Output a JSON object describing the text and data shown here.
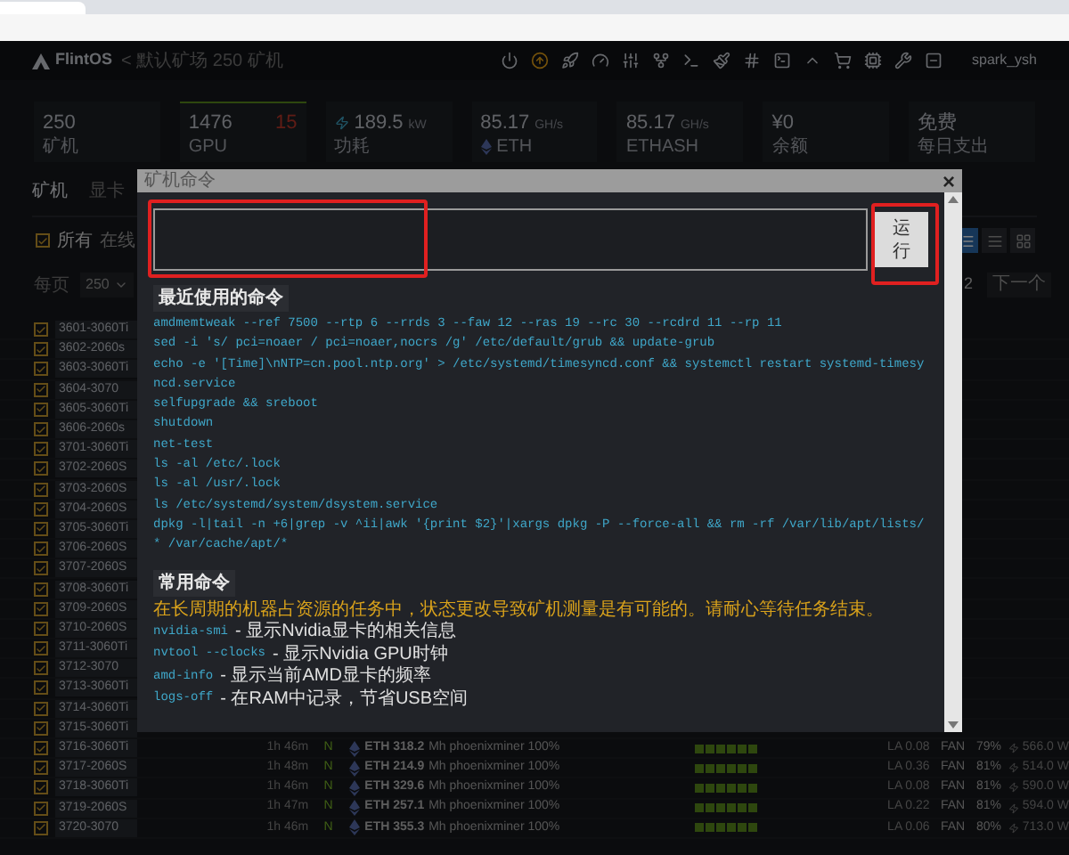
{
  "header": {
    "logo": "FlintOS",
    "breadcrumb": "< 默认矿场 250 矿机",
    "user": "spark_ysh"
  },
  "stats": [
    {
      "value": "250",
      "label": "矿机",
      "selected": false
    },
    {
      "value": "1476",
      "alert": "15",
      "label": "GPU",
      "selected": true
    },
    {
      "value": "189.5",
      "unit": "kW",
      "label": "功耗",
      "kind": "power",
      "selected": false
    },
    {
      "value": "85.17",
      "unit": "GH/s",
      "label": "ETH",
      "kind": "eth",
      "selected": false
    },
    {
      "value": "85.17",
      "unit": "GH/s",
      "label": "ETHASH",
      "selected": false
    },
    {
      "value": "¥0",
      "label": "余额",
      "selected": false
    },
    {
      "value": "免费",
      "label": "每日支出",
      "selected": false
    }
  ],
  "tabs": [
    {
      "label": "矿机",
      "selected": true
    },
    {
      "label": "显卡",
      "selected": false
    }
  ],
  "filter": {
    "checked": true,
    "label": "所有",
    "next": "在线"
  },
  "per_page": {
    "label": "每页",
    "value": "250"
  },
  "views": [
    {
      "kind": "list",
      "selected": true
    },
    {
      "kind": "table",
      "selected": false
    },
    {
      "kind": "grid",
      "selected": false
    }
  ],
  "pagination": {
    "page": "2",
    "next": "下一个"
  },
  "rows": [
    {
      "name": "3601-3060Ti",
      "checked": true
    },
    {
      "name": "3602-2060s",
      "checked": true
    },
    {
      "name": "3603-3060Ti",
      "checked": true
    },
    {
      "name": "3604-3070",
      "checked": true
    },
    {
      "name": "3605-3060Ti",
      "checked": true
    },
    {
      "name": "3606-2060s",
      "checked": true
    },
    {
      "name": "3701-3060Ti",
      "checked": true
    },
    {
      "name": "3702-2060S",
      "checked": true
    },
    {
      "name": "3703-2060S",
      "checked": true
    },
    {
      "name": "3704-2060S",
      "checked": true
    },
    {
      "name": "3705-3060Ti",
      "checked": true
    },
    {
      "name": "3706-2060S",
      "checked": true
    },
    {
      "name": "3707-2060S",
      "checked": true
    },
    {
      "name": "3708-3060Ti",
      "checked": true
    },
    {
      "name": "3709-2060S",
      "checked": true
    },
    {
      "name": "3710-2060S",
      "checked": true
    },
    {
      "name": "3711-3060Ti",
      "checked": true
    },
    {
      "name": "3712-3070",
      "checked": true
    },
    {
      "name": "3713-3060Ti",
      "checked": true
    },
    {
      "name": "3714-3060Ti",
      "checked": true
    },
    {
      "name": "3715-3060Ti",
      "checked": true
    },
    {
      "name": "3716-3060Ti",
      "checked": true,
      "details": {
        "uptime": "1h 46m",
        "flag": "N",
        "coin": "ETH",
        "hashrate": "318.2",
        "miner": "Mh phoenixminer 100%",
        "la": "LA 0.08",
        "fan_label": "FAN",
        "fan": "79%",
        "power": "566.0 W"
      }
    },
    {
      "name": "3717-2060S",
      "checked": true,
      "details": {
        "uptime": "1h 48m",
        "flag": "N",
        "coin": "ETH",
        "hashrate": "214.9",
        "miner": "Mh phoenixminer 100%",
        "la": "LA 0.36",
        "fan_label": "FAN",
        "fan": "81%",
        "power": "514.0 W"
      }
    },
    {
      "name": "3718-3060Ti",
      "checked": true,
      "details": {
        "uptime": "1h 46m",
        "flag": "N",
        "coin": "ETH",
        "hashrate": "329.6",
        "miner": "Mh phoenixminer 100%",
        "la": "LA 0.08",
        "fan_label": "FAN",
        "fan": "81%",
        "power": "590.0 W"
      }
    },
    {
      "name": "3719-2060S",
      "checked": true,
      "details": {
        "uptime": "1h 47m",
        "flag": "N",
        "coin": "ETH",
        "hashrate": "257.1",
        "miner": "Mh phoenixminer 100%",
        "la": "LA 0.22",
        "fan_label": "FAN",
        "fan": "81%",
        "power": "594.0 W"
      }
    },
    {
      "name": "3720-3070",
      "checked": true,
      "details": {
        "uptime": "1h 46m",
        "flag": "N",
        "coin": "ETH",
        "hashrate": "355.3",
        "miner": "Mh phoenixminer 100%",
        "la": "LA 0.06",
        "fan_label": "FAN",
        "fan": "80%",
        "power": "713.0 W"
      }
    }
  ],
  "modal": {
    "title": "矿机命令",
    "close": "×",
    "run_button": "运行",
    "recent_title": "最近使用的命令",
    "recent": [
      "amdmemtweak --ref 7500 --rtp 6 --rrds 3 --faw 12 --ras 19 --rc 30 --rcdrd 11 --rp 11",
      "sed -i 's/ pci=noaer / pci=noaer,nocrs /g' /etc/default/grub && update-grub",
      "echo -e '[Time]\\nNTP=cn.pool.ntp.org' > /etc/systemd/timesyncd.conf && systemctl restart systemd-timesyncd.service",
      "selfupgrade && sreboot",
      "shutdown",
      "net-test",
      "ls -al /etc/.lock",
      "ls -al /usr/.lock",
      "ls /etc/systemd/system/dsystem.service",
      "dpkg -l|tail -n +6|grep -v ^ii|awk '{print $2}'|xargs dpkg -P --force-all && rm -rf /var/lib/apt/lists/* /var/cache/apt/*"
    ],
    "common_title": "常用命令",
    "warning": "在长周期的机器占资源的任务中，状态更改导致矿机测量是有可能的。请耐心等待任务结束。",
    "common": [
      {
        "command": "nvidia-smi",
        "description": "- 显示Nvidia显卡的相关信息"
      },
      {
        "command": "nvtool --clocks",
        "description": "- 显示Nvidia GPU时钟"
      },
      {
        "command": "amd-info",
        "description": "- 显示当前AMD显卡的频率"
      },
      {
        "command": "logs-off",
        "description": "- 在RAM中记录，节省USB空间"
      }
    ]
  }
}
